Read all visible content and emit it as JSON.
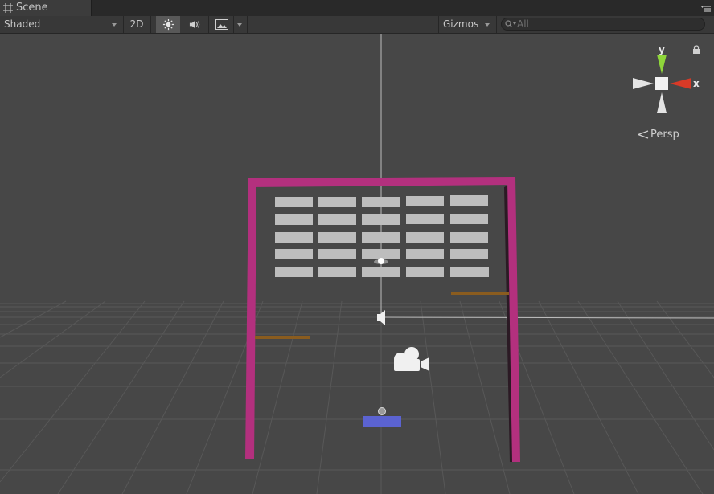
{
  "tab": {
    "label": "Scene"
  },
  "toolbar": {
    "shading_mode": "Shaded",
    "mode_2d": "2D",
    "gizmos_label": "Gizmos"
  },
  "search": {
    "placeholder": "All"
  },
  "scene_gizmo": {
    "projection_label": "Persp",
    "axis_y": "y",
    "axis_x": "x"
  },
  "colors": {
    "walls": "#b3307e",
    "bricks": "#bdbdbd",
    "paddle": "#5b63d1",
    "ledges": "#8a5c1f",
    "axis_x": "#d93a27",
    "axis_y": "#8fd63a",
    "grid": "#595959"
  },
  "icons": {
    "tab": "scene-grid-icon",
    "lighting": "sun-icon",
    "audio": "speaker-icon",
    "effects": "image-icon",
    "search": "search-icon",
    "camera": "camera-icon",
    "audio_source": "audio-source-icon",
    "lock": "lock-icon",
    "projection": "persp-icon"
  }
}
